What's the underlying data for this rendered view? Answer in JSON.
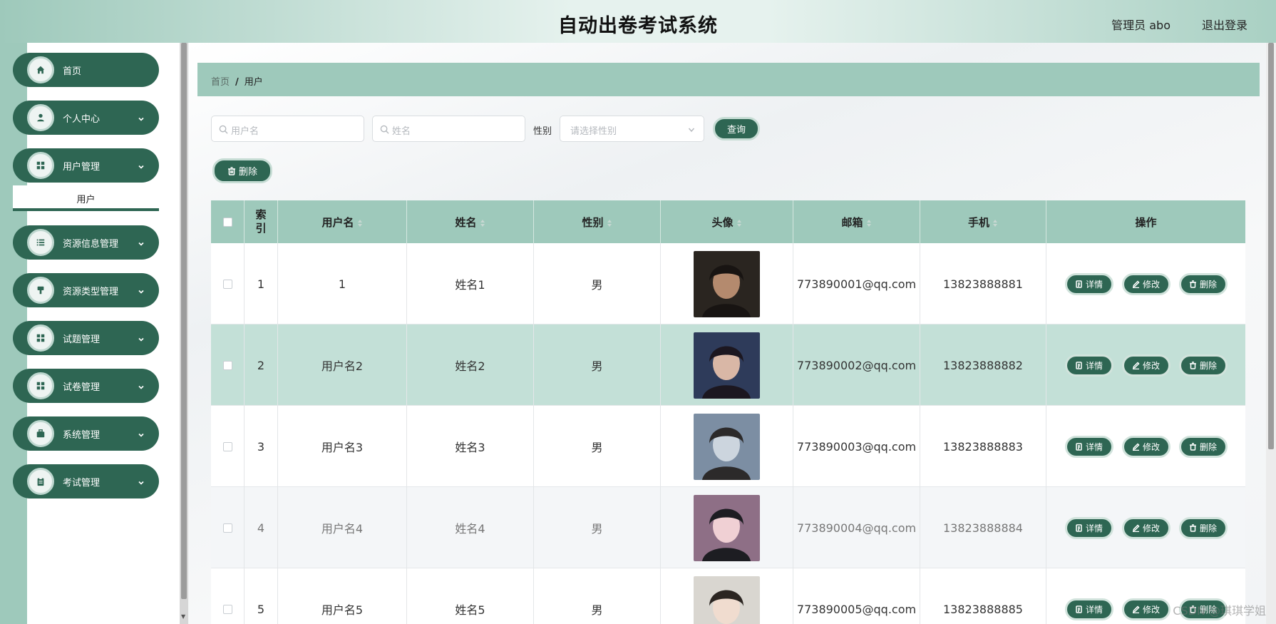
{
  "header": {
    "title": "自动出卷考试系统",
    "admin_label": "管理员 abo",
    "logout_label": "退出登录"
  },
  "sidebar": {
    "items": [
      {
        "label": "首页",
        "icon": "home-icon"
      },
      {
        "label": "个人中心",
        "icon": "user-icon"
      },
      {
        "label": "用户管理",
        "icon": "grid-icon"
      },
      {
        "label": "资源信息管理",
        "icon": "list-icon"
      },
      {
        "label": "资源类型管理",
        "icon": "brush-icon"
      },
      {
        "label": "试题管理",
        "icon": "grid-icon"
      },
      {
        "label": "试卷管理",
        "icon": "grid-icon"
      },
      {
        "label": "系统管理",
        "icon": "briefcase-icon"
      },
      {
        "label": "考试管理",
        "icon": "clipboard-icon"
      }
    ],
    "submenu_active": "用户"
  },
  "breadcrumb": {
    "home": "首页",
    "separator": "/",
    "current": "用户"
  },
  "search": {
    "username_placeholder": "用户名",
    "name_placeholder": "姓名",
    "gender_label": "性别",
    "gender_placeholder": "请选择性别",
    "query_button": "查询"
  },
  "toolbar": {
    "delete_button": "删除"
  },
  "table": {
    "headers": {
      "index": "索引",
      "username": "用户名",
      "name": "姓名",
      "gender": "性别",
      "avatar": "头像",
      "email": "邮箱",
      "phone": "手机",
      "actions": "操作"
    },
    "action_labels": {
      "detail": "详情",
      "edit": "修改",
      "delete": "删除"
    },
    "rows": [
      {
        "index": "1",
        "username": "1",
        "name": "姓名1",
        "gender": "男",
        "email": "773890001@qq.com",
        "phone": "13823888881"
      },
      {
        "index": "2",
        "username": "用户名2",
        "name": "姓名2",
        "gender": "男",
        "email": "773890002@qq.com",
        "phone": "13823888882"
      },
      {
        "index": "3",
        "username": "用户名3",
        "name": "姓名3",
        "gender": "男",
        "email": "773890003@qq.com",
        "phone": "13823888883"
      },
      {
        "index": "4",
        "username": "用户名4",
        "name": "姓名4",
        "gender": "男",
        "email": "773890004@qq.com",
        "phone": "13823888884"
      },
      {
        "index": "5",
        "username": "用户名5",
        "name": "姓名5",
        "gender": "男",
        "email": "773890005@qq.com",
        "phone": "13823888885"
      }
    ]
  },
  "watermark": "CSDN @琪琪学姐",
  "colors": {
    "primary": "#2e6653",
    "accent_light": "#9ec9bb",
    "row_highlight": "#c3e0d7",
    "row_alt": "#f4f6f8"
  }
}
